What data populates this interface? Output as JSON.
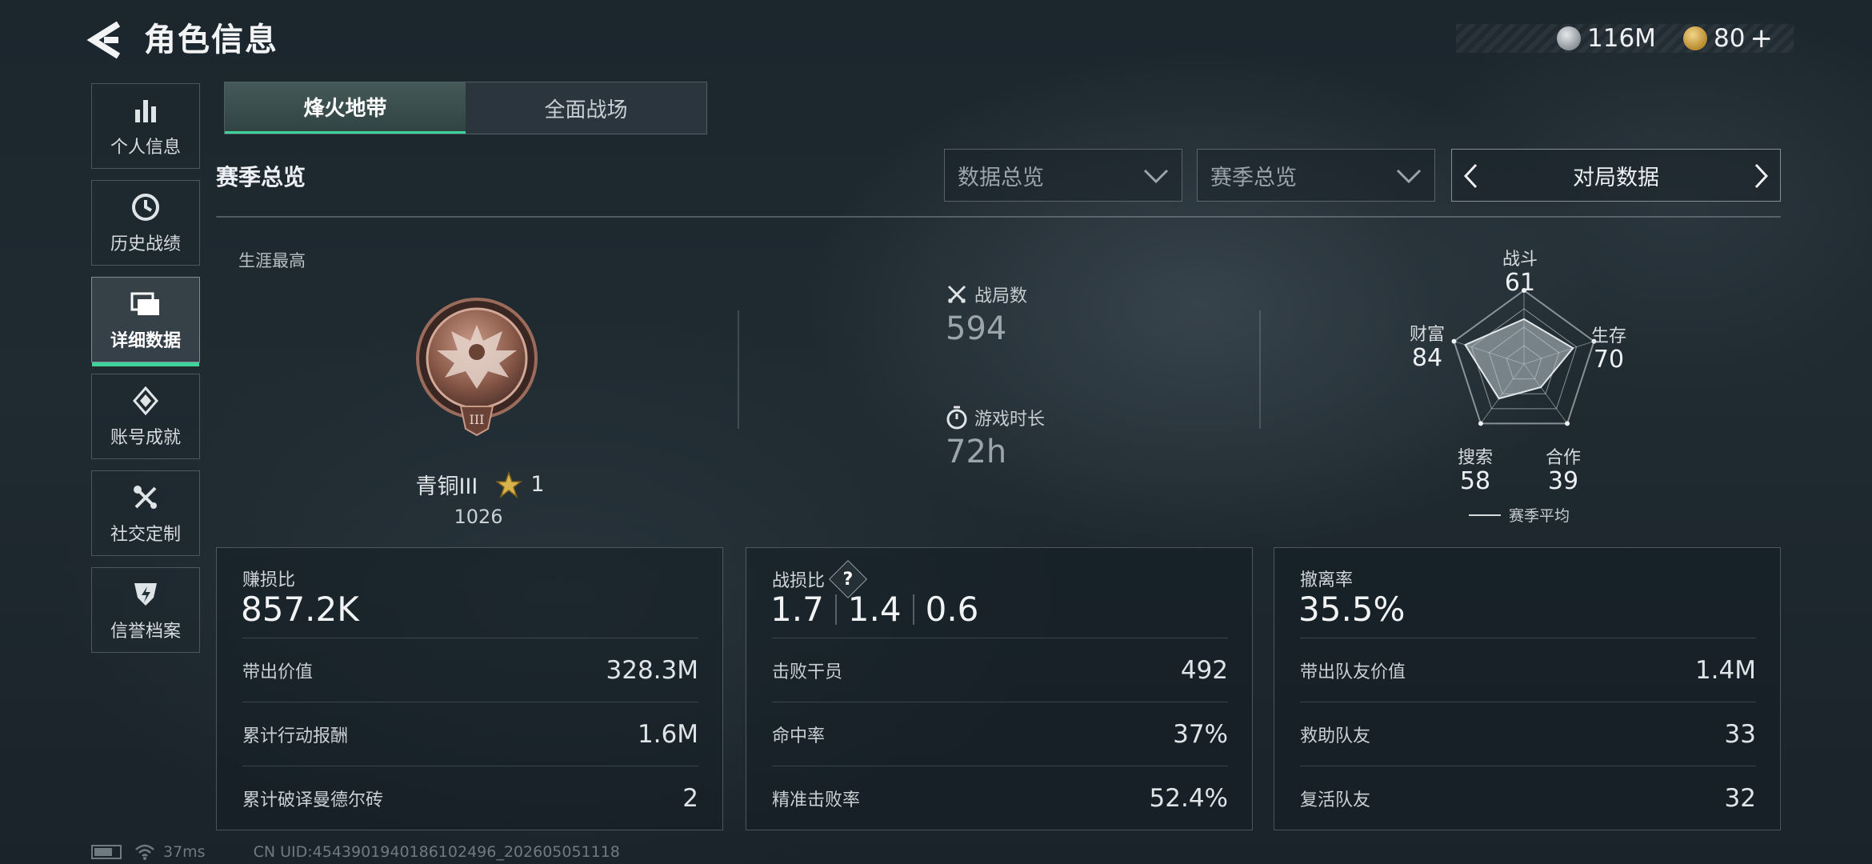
{
  "header": {
    "title": "角色信息",
    "currency": [
      {
        "icon": "silver-coin-icon",
        "value": "116M"
      },
      {
        "icon": "gold-coin-icon",
        "value": "80",
        "suffix": "+"
      }
    ]
  },
  "sidebar": {
    "items": [
      {
        "label": "个人信息",
        "icon": "bar-chart-icon",
        "active": false
      },
      {
        "label": "历史战绩",
        "icon": "clock-icon",
        "active": false
      },
      {
        "label": "详细数据",
        "icon": "folders-icon",
        "active": true
      },
      {
        "label": "账号成就",
        "icon": "achievement-icon",
        "active": false
      },
      {
        "label": "社交定制",
        "icon": "tools-icon",
        "active": false
      },
      {
        "label": "信誉档案",
        "icon": "reputation-icon",
        "active": false
      }
    ]
  },
  "tabs": [
    {
      "label": "烽火地带",
      "active": true
    },
    {
      "label": "全面战场",
      "active": false
    }
  ],
  "section": {
    "title": "赛季总览",
    "filter1": "数据总览",
    "filter2": "赛季总览",
    "selector": "对局数据"
  },
  "career": {
    "label": "生涯最高",
    "rank_name": "青铜III",
    "stars": "1",
    "score": "1026"
  },
  "overview": {
    "matches_label": "战局数",
    "matches_value": "594",
    "playtime_label": "游戏时长",
    "playtime_value": "72h"
  },
  "radar": {
    "axes": [
      {
        "label": "战斗",
        "value": "61"
      },
      {
        "label": "生存",
        "value": "70"
      },
      {
        "label": "合作",
        "value": "39"
      },
      {
        "label": "搜索",
        "value": "58"
      },
      {
        "label": "财富",
        "value": "84"
      }
    ],
    "legend": "赛季平均"
  },
  "cards": {
    "profit": {
      "title": "赚损比",
      "value": "857.2K",
      "rows": [
        {
          "label": "带出价值",
          "value": "328.3M"
        },
        {
          "label": "累计行动报酬",
          "value": "1.6M"
        },
        {
          "label": "累计破译曼德尔砖",
          "value": "2"
        }
      ]
    },
    "kd": {
      "title": "战损比",
      "help": "?",
      "values": [
        "1.7",
        "1.4",
        "0.6"
      ],
      "rows": [
        {
          "label": "击败干员",
          "value": "492"
        },
        {
          "label": "命中率",
          "value": "37%"
        },
        {
          "label": "精准击败率",
          "value": "52.4%"
        }
      ]
    },
    "extract": {
      "title": "撤离率",
      "value": "35.5%",
      "rows": [
        {
          "label": "带出队友价值",
          "value": "1.4M"
        },
        {
          "label": "救助队友",
          "value": "33"
        },
        {
          "label": "复活队友",
          "value": "32"
        }
      ]
    }
  },
  "footer": {
    "ping": "37ms",
    "uid": "CN UID:4543901940186102496_202605051118"
  }
}
